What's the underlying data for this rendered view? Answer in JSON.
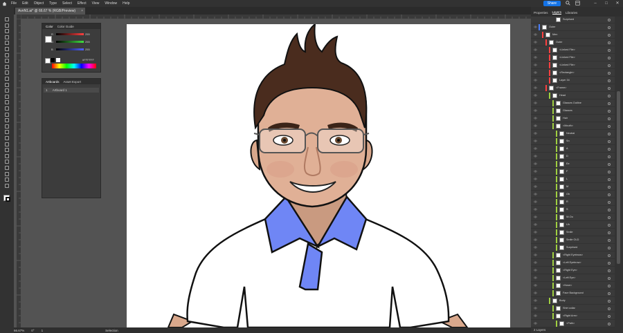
{
  "menu": [
    "File",
    "Edit",
    "Object",
    "Type",
    "Select",
    "Effect",
    "View",
    "Window",
    "Help"
  ],
  "share_label": "Share",
  "document_tab": {
    "title": "AvnN1.ai* @ 66.67 % (RGB/Preview)",
    "close": "×"
  },
  "color_panel": {
    "tabs": [
      "Color",
      "Color Guide"
    ],
    "sliders": [
      {
        "channel": "R",
        "value": "255",
        "color": "#ff4040"
      },
      {
        "channel": "G",
        "value": "255",
        "color": "#40e040"
      },
      {
        "channel": "B",
        "value": "255",
        "color": "#5060ff"
      }
    ],
    "hex": "FFFFFF"
  },
  "artboards_panel": {
    "tabs": [
      "Artboards",
      "Asset Export"
    ],
    "items": [
      {
        "num": "1",
        "name": "Artboard 1"
      }
    ]
  },
  "right_dock": {
    "tabs": [
      "Properties",
      "Layers",
      "Libraries"
    ],
    "layers_status": "2 Layers"
  },
  "layers": [
    {
      "name": "Outer",
      "indent": 0,
      "color": "#4a7fff"
    },
    {
      "name": "Men",
      "indent": 1,
      "color": "#ff4040"
    },
    {
      "name": "Outer",
      "indent": 2,
      "color": "#ff4040"
    },
    {
      "name": "<Linked File>",
      "indent": 3,
      "color": "#ff4040"
    },
    {
      "name": "<Linked File>",
      "indent": 3,
      "color": "#ff4040"
    },
    {
      "name": "<Linked File>",
      "indent": 3,
      "color": "#ff4040"
    },
    {
      "name": "<Rectangle>",
      "indent": 3,
      "color": "#ff4040"
    },
    {
      "name": "Layer 34",
      "indent": 3,
      "color": "#ff4040"
    },
    {
      "name": "<Frame>",
      "indent": 2,
      "color": "#ff4040"
    },
    {
      "name": "Head",
      "indent": 3,
      "color": "#a0d040"
    },
    {
      "name": "Glasses Outline",
      "indent": 4,
      "color": "#a0d040"
    },
    {
      "name": "Glasses",
      "indent": 4,
      "color": "#a0d040"
    },
    {
      "name": "Hair",
      "indent": 4,
      "color": "#a0d040"
    },
    {
      "name": "<Mouth>",
      "indent": 4,
      "color": "#a0d040"
    },
    {
      "name": "Neutral",
      "indent": 5,
      "color": "#a0d040"
    },
    {
      "name": "Sn",
      "indent": 5,
      "color": "#a0d040"
    },
    {
      "name": "A",
      "indent": 5,
      "color": "#a0d040"
    },
    {
      "name": "D",
      "indent": 5,
      "color": "#a0d040"
    },
    {
      "name": "Ee",
      "indent": 5,
      "color": "#a0d040"
    },
    {
      "name": "F",
      "indent": 5,
      "color": "#a0d040"
    },
    {
      "name": "L",
      "indent": 5,
      "color": "#a0d040"
    },
    {
      "name": "M",
      "indent": 5,
      "color": "#a0d040"
    },
    {
      "name": "Oh",
      "indent": 5,
      "color": "#a0d040"
    },
    {
      "name": "R",
      "indent": 5,
      "color": "#a0d040"
    },
    {
      "name": "S",
      "indent": 5,
      "color": "#a0d040"
    },
    {
      "name": "W-Oo",
      "indent": 5,
      "color": "#a0d040"
    },
    {
      "name": "Uh",
      "indent": 5,
      "color": "#a0d040"
    },
    {
      "name": "Smile",
      "indent": 5,
      "color": "#a0d040"
    },
    {
      "name": "Smile OLD",
      "indent": 5,
      "color": "#a0d040"
    },
    {
      "name": "Surprised",
      "indent": 5,
      "color": "#a0d040"
    },
    {
      "name": "<Right Eyebrow>",
      "indent": 4,
      "color": "#a0d040"
    },
    {
      "name": "<Left Eyebrow>",
      "indent": 4,
      "color": "#a0d040"
    },
    {
      "name": "<Right Eye>",
      "indent": 4,
      "color": "#a0d040"
    },
    {
      "name": "<Left Eye>",
      "indent": 4,
      "color": "#a0d040"
    },
    {
      "name": "<Nose>",
      "indent": 4,
      "color": "#a0d040"
    },
    {
      "name": "Face Background",
      "indent": 4,
      "color": "#a0d040"
    },
    {
      "name": "Body",
      "indent": 3,
      "color": "#a0d040"
    },
    {
      "name": "Shirt collar",
      "indent": 4,
      "color": "#a0d040"
    },
    {
      "name": "<Right Arm>",
      "indent": 4,
      "color": "#a0d040"
    },
    {
      "name": "<Path>",
      "indent": 5,
      "color": "#a0d040"
    }
  ],
  "layers_top": {
    "name": "Surprised"
  },
  "status": {
    "zoom": "66.67%",
    "rotate": "0°",
    "page": "1",
    "tool": "Selection"
  },
  "colors": {
    "skin": "#d9a88c",
    "hair": "#4a2c1e",
    "collar": "#6f86f5",
    "shirt": "#ffffff",
    "outline": "#111111",
    "accent": "#1473e6"
  }
}
